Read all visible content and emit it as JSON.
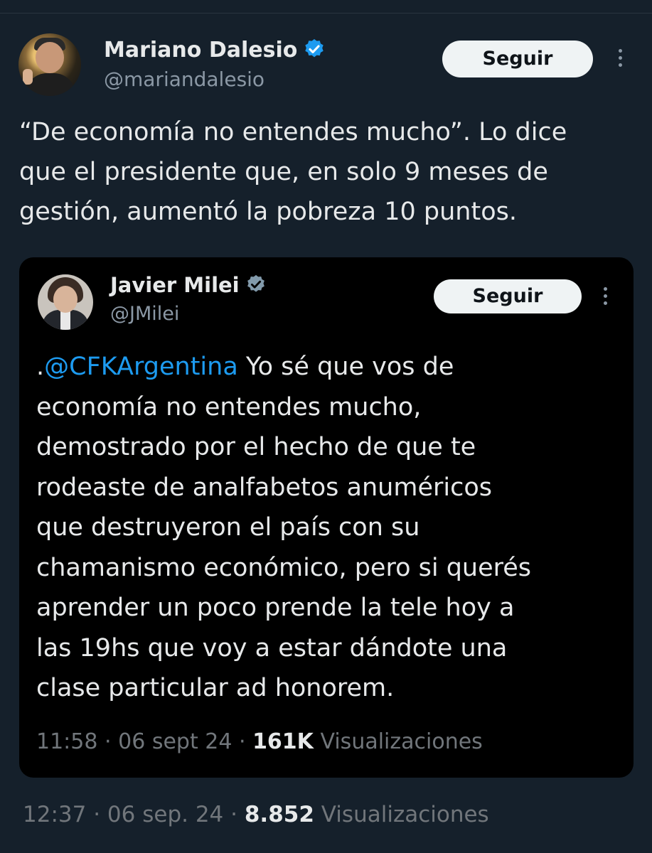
{
  "tweet": {
    "author": {
      "name": "Mariano Dalesio",
      "handle": "@mariandalesio"
    },
    "follow_label": "Seguir",
    "text": "“De economía no entendes mucho”. Lo dice\nque el presidente que, en solo 9 meses de\ngestión, aumentó la pobreza 10 puntos.",
    "time": "12:37",
    "date": "06 sep. 24",
    "views": "8.852",
    "views_label": "Visualizaciones",
    "sep": "·"
  },
  "quoted": {
    "author": {
      "name": "Javier Milei",
      "handle": "@JMilei"
    },
    "follow_label": "Seguir",
    "prefix": ".",
    "mention": "@CFKArgentina",
    "text": " Yo sé que vos de\neconomía no entendes mucho,\ndemostrado por el hecho de que te\nrodeaste de analfabetos anuméricos\nque destruyeron el país con su\nchamanismo económico, pero si querés\naprender un poco prende la tele hoy a\nlas 19hs que voy a estar dándote una\nclase particular ad honorem.",
    "time": "11:58",
    "date": "06 sept 24",
    "views": "161K",
    "views_label": "Visualizaciones",
    "sep": "·"
  },
  "colors": {
    "background": "#15202b",
    "quote_background": "#000000",
    "link": "#1d9bf0",
    "verified": "#1d9bf0",
    "verified_gray": "#829aab",
    "secondary_text": "#8b98a5"
  }
}
